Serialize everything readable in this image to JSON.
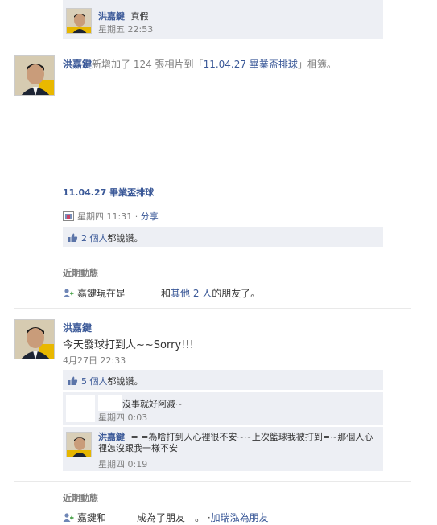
{
  "top_comment": {
    "author": "洪嘉鍵",
    "text": "真假",
    "time": "星期五 22:53"
  },
  "album_story": {
    "author": "洪嘉鍵",
    "action_prefix": "新增加了 124 張相片到「",
    "album_name": "11.04.27 畢業盃排球",
    "action_suffix": "」相簿。",
    "album_title": "11.04.27 畢業盃排球",
    "time": "星期四 11:31",
    "separator": "·",
    "share": "分享",
    "likes_count": "2 個人",
    "likes_suffix": "都說讚。"
  },
  "recent_1": {
    "title": "近期動態",
    "friend_prefix": "嘉鍵現在是",
    "friend_middle": "和",
    "friend_others": "其他 2 人",
    "friend_suffix": "的朋友了。"
  },
  "status_story": {
    "author": "洪嘉鍵",
    "text": "今天發球打到人~~Sorry!!!",
    "time": "4月27日 22:33",
    "likes_count": "5 個人",
    "likes_suffix": "都說讚。",
    "comments": [
      {
        "author": "",
        "text": "沒事就好阿減~",
        "time": "星期四 0:03"
      },
      {
        "author": "洪嘉鍵",
        "text": "= =為啥打到人心裡很不安~~上次籃球我被打到=~那個人心裡怎沒跟我一樣不安",
        "time": "星期四 0:19"
      }
    ]
  },
  "recent_2": {
    "title": "近期動態",
    "friend_prefix": "嘉鍵和",
    "friend_middle": "成為了朋友",
    "friend_dot": "。 ·",
    "add_friend": "加瑞泓為朋友"
  },
  "colors": {
    "link": "#3b5998",
    "comment_bg": "#edeff4",
    "meta": "#808080"
  }
}
